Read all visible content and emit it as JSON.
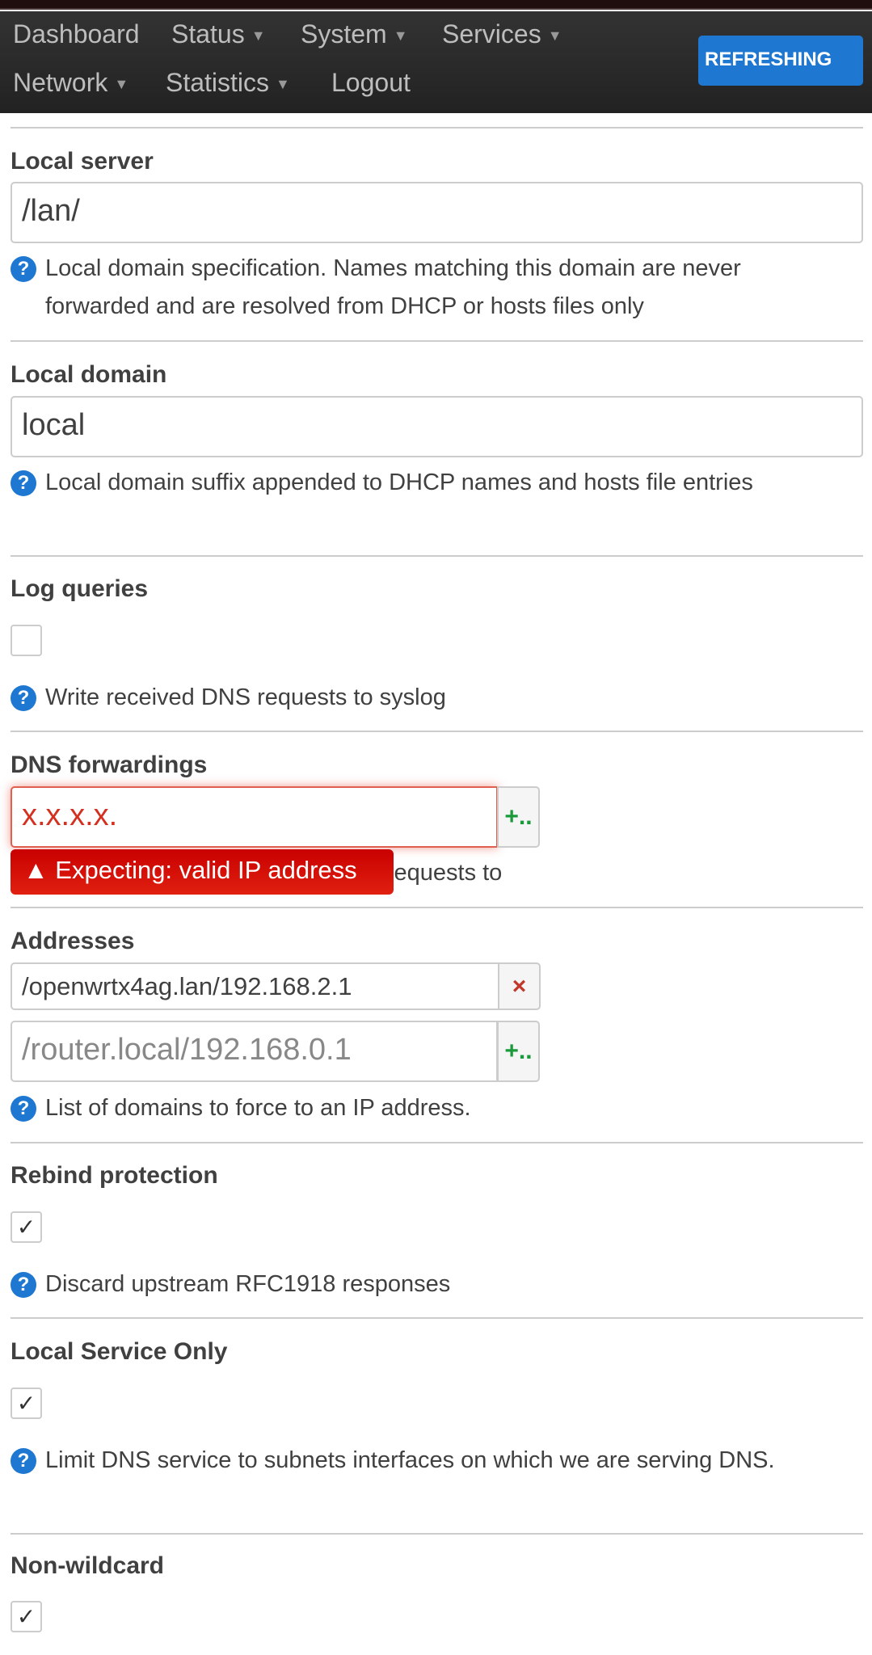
{
  "nav": {
    "items": [
      {
        "label": "Dashboard",
        "caret": false
      },
      {
        "label": "Status",
        "caret": true
      },
      {
        "label": "System",
        "caret": true
      },
      {
        "label": "Services",
        "caret": true
      },
      {
        "label": "Network",
        "caret": true
      },
      {
        "label": "Statistics",
        "caret": true
      },
      {
        "label": "Logout",
        "caret": false
      }
    ],
    "refresh_label": "REFRESHING",
    "caret": "▼"
  },
  "local_server": {
    "label": "Local server",
    "value": "/lan/",
    "help": "Local domain specification. Names matching this domain are never forwarded and are resolved from DHCP or hosts files only"
  },
  "local_domain": {
    "label": "Local domain",
    "value": "local",
    "help": "Local domain suffix appended to DHCP names and hosts file entries"
  },
  "log_queries": {
    "label": "Log queries",
    "checked": false,
    "help": "Write received DNS requests to syslog"
  },
  "dns_forwardings": {
    "label": "DNS forwardings",
    "value": "x.x.x.x.",
    "add_label": "+..",
    "error": "▲ Expecting: valid IP address",
    "help_visible": "rd requests to"
  },
  "addresses": {
    "label": "Addresses",
    "values": [
      "/openwrtx4ag.lan/192.168.2.1"
    ],
    "remove_label": "×",
    "placeholder": "/router.local/192.168.0.1",
    "add_label": "+..",
    "help": "List of domains to force to an IP address."
  },
  "rebind": {
    "label": "Rebind protection",
    "checked": true,
    "help": "Discard upstream RFC1918 responses"
  },
  "local_service": {
    "label": "Local Service Only",
    "checked": true,
    "help": "Limit DNS service to subnets interfaces on which we are serving DNS."
  },
  "non_wildcard": {
    "label": "Non-wildcard",
    "checked": true
  },
  "help_icon": "?",
  "check_mark": "✓",
  "colors": {
    "accent": "#1e78d2",
    "error": "#d40000",
    "add": "#1a9a3a",
    "remove": "#c0392b"
  }
}
